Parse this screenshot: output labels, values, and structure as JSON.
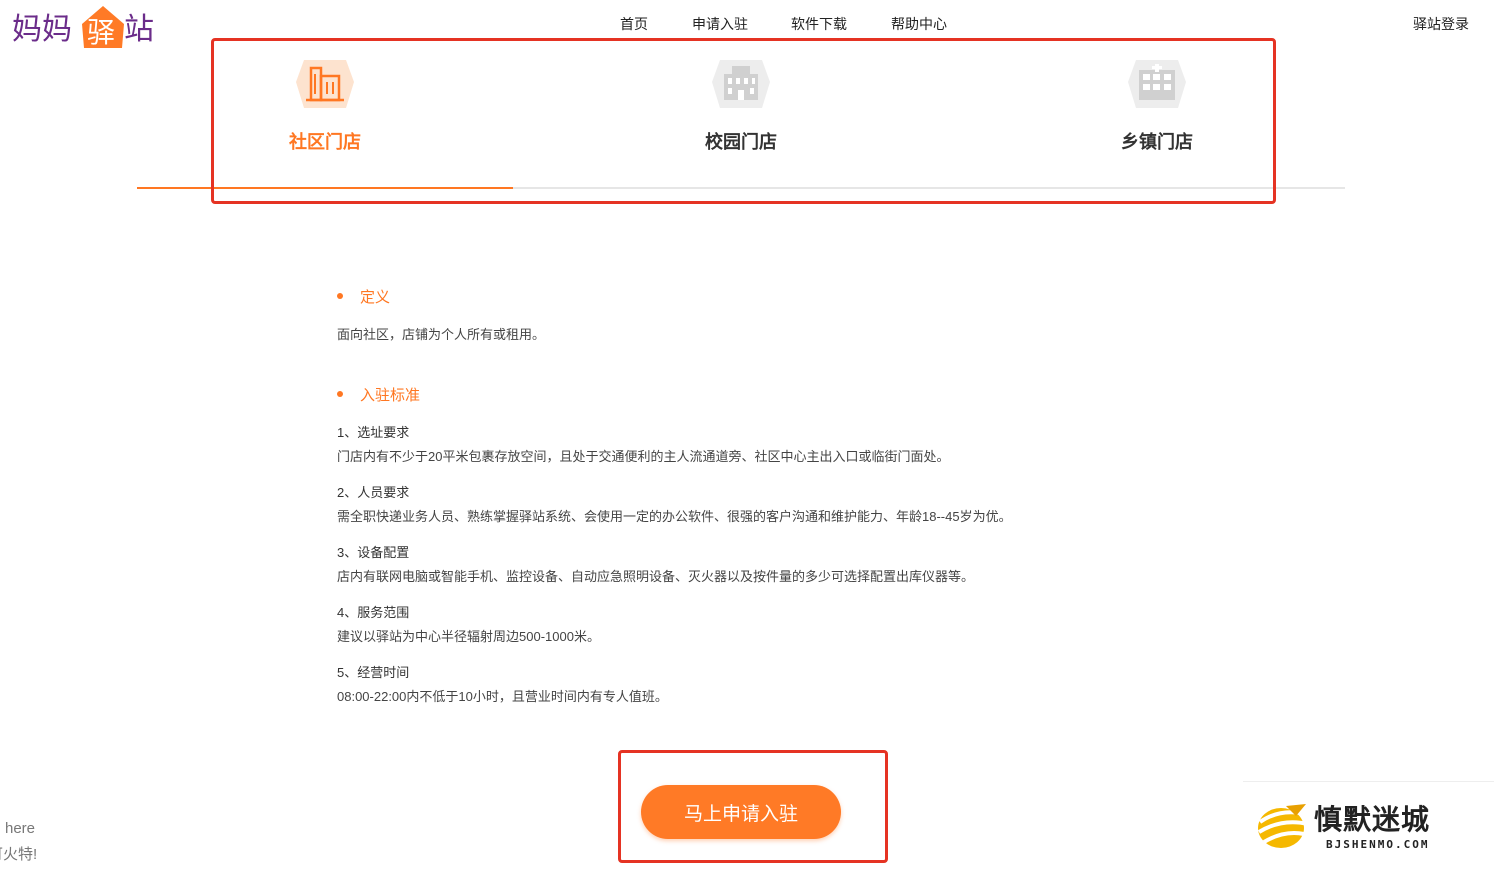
{
  "brand": {
    "logo_text": "妈妈驿站"
  },
  "nav": {
    "items": [
      {
        "label": "首页"
      },
      {
        "label": "申请入驻"
      },
      {
        "label": "软件下载"
      },
      {
        "label": "帮助中心"
      }
    ],
    "login_label": "驿站登录"
  },
  "tabs": [
    {
      "label": "社区门店",
      "icon": "community-building-icon",
      "active": true
    },
    {
      "label": "校园门店",
      "icon": "campus-building-icon",
      "active": false
    },
    {
      "label": "乡镇门店",
      "icon": "town-building-icon",
      "active": false
    }
  ],
  "definition": {
    "title": "定义",
    "text": "面向社区，店铺为个人所有或租用。"
  },
  "standards": {
    "title": "入驻标准",
    "items": [
      {
        "heading": "1、选址要求",
        "text": "门店内有不少于20平米包裹存放空间，且处于交通便利的主人流通道旁、社区中心主出入口或临街门面处。"
      },
      {
        "heading": "2、人员要求",
        "text": "需全职快递业务人员、熟练掌握驿站系统、会使用一定的办公软件、很强的客户沟通和维护能力、年龄18--45岁为优。"
      },
      {
        "heading": "3、设备配置",
        "text": "店内有联网电脑或智能手机、监控设备、自动应急照明设备、灭火器以及按件量的多少可选择配置出库仪器等。"
      },
      {
        "heading": "4、服务范围",
        "text": "建议以驿站为中心半径辐射周边500-1000米。"
      },
      {
        "heading": "5、经营时间",
        "text": "08:00-22:00内不低于10小时，且营业时间内有专人值班。"
      }
    ]
  },
  "apply_button": {
    "label": "马上申请入驻"
  },
  "fragments": {
    "line1": "here",
    "line2": "可火特!"
  },
  "watermark": {
    "title": "慎默迷城",
    "subtitle": "BJSHENMO.COM"
  },
  "colors": {
    "accent": "#ff7722",
    "highlight_box": "#e53323",
    "inactive_icon": "#d4d4d4"
  }
}
